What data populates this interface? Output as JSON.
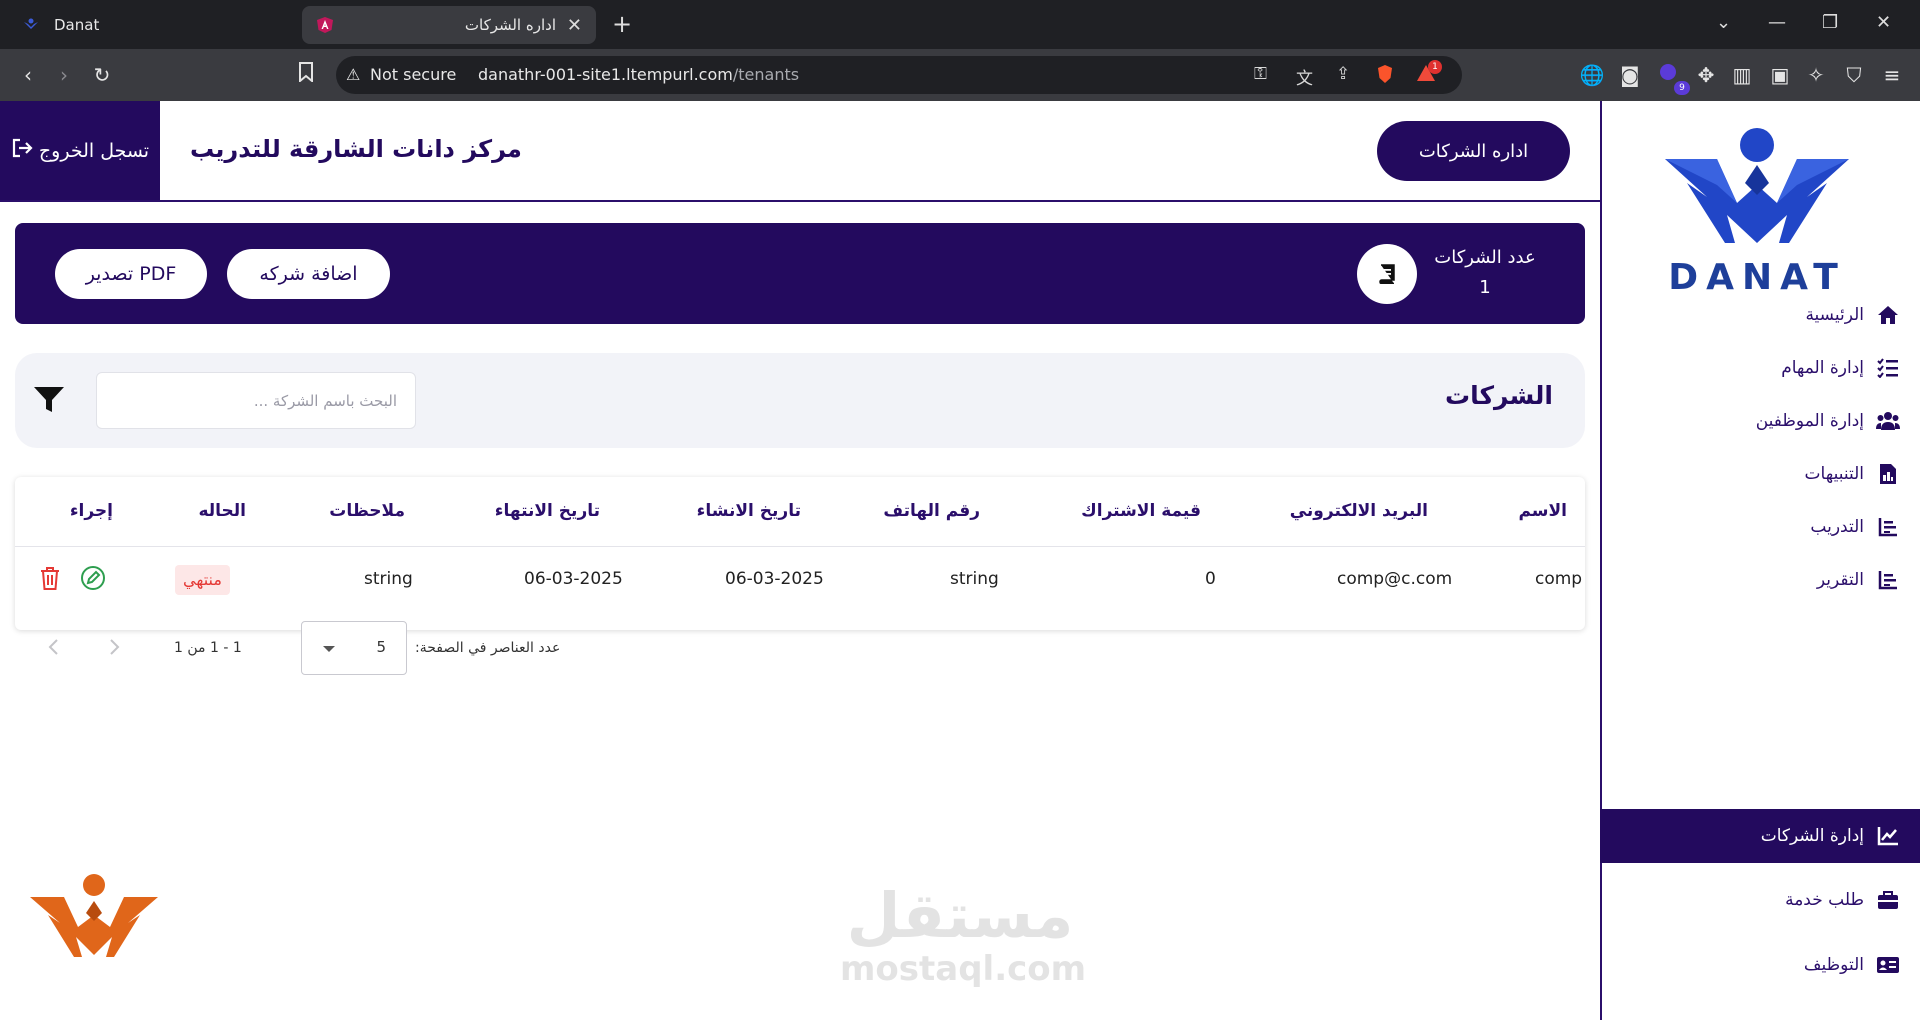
{
  "browser": {
    "tabs": [
      {
        "title": "Danat"
      },
      {
        "title": "اداره الشركات"
      }
    ],
    "new_tab": "+",
    "not_secure": "Not secure",
    "url_host": "danathr-001-site1.ltempurl.com",
    "url_path": "/tenants",
    "notif_count": "1",
    "ext_count": "9"
  },
  "header": {
    "logout_label": "تسجل الخروج",
    "center_name": "مركز دانات الشارقة للتدريب",
    "manage_companies_button": "اداره الشركات"
  },
  "sidebar": {
    "logo_text": "DANAT",
    "items": [
      {
        "label": "الرئيسية",
        "icon": "home-icon"
      },
      {
        "label": "إدارة المهام",
        "icon": "checklist-icon"
      },
      {
        "label": "إدارة الموظفين",
        "icon": "users-icon"
      },
      {
        "label": "التنبيهات",
        "icon": "document-icon"
      },
      {
        "label": "التدريب",
        "icon": "chart-icon"
      },
      {
        "label": "التقرير",
        "icon": "chart-icon"
      },
      {
        "label": "إدارة الشركات",
        "icon": "trend-icon",
        "active": true
      },
      {
        "label": "طلب خدمة",
        "icon": "briefcase-icon"
      },
      {
        "label": "التوظيف",
        "icon": "id-card-icon"
      }
    ]
  },
  "banner": {
    "count_label": "عدد الشركات",
    "count_value": "1",
    "add_button": "اضافة شركه",
    "export_button": "تصدير PDF"
  },
  "search": {
    "title": "الشركات",
    "placeholder": "البحث باسم الشركة ..."
  },
  "table": {
    "columns": [
      "الاسم",
      "البريد الالكتروني",
      "قيمة الاشتراك",
      "رقم الهاتف",
      "تاريخ الانشاء",
      "تاريخ الانتهاء",
      "ملاحظات",
      "الحاله",
      "إجراء"
    ],
    "rows": [
      {
        "name": "comp",
        "email": "comp@c.com",
        "subscription": "0",
        "phone": "string",
        "created": "06-03-2025",
        "expires": "06-03-2025",
        "notes": "string",
        "status": "منتهي"
      }
    ]
  },
  "pagination": {
    "per_page_label": "عدد العناصر في الصفحة:",
    "per_page_value": "5",
    "range_label": "1 - 1 من 1"
  },
  "watermark": {
    "arabic": "مستقل",
    "latin": "mostaql.com"
  },
  "colors": {
    "primary": "#230a5e",
    "logo_blue": "#1e3f9a",
    "danger": "#e53935",
    "success": "#2e9e4f",
    "accent_orange": "#e0661a"
  }
}
